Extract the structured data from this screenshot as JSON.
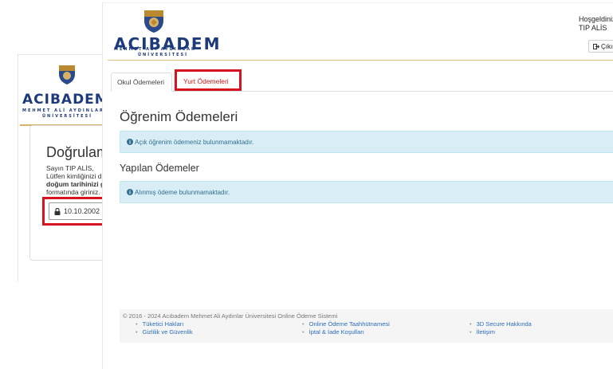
{
  "brand": {
    "name": "ACIBADEM",
    "sub_line1": "MEHMET ALİ AYDINLAR",
    "sub_line2": "ÜNİVERSİTESİ",
    "gold": "#d8b26a",
    "navy": "#1d3a7a"
  },
  "background_window": {
    "title": "Doğrulama",
    "text_line1": "Sayın TIP ALİS,",
    "text_line2": "Lütfen kimliğinizi d",
    "text_line3": "doğum tarihinizi gü",
    "text_line4": "formatında giriniz.",
    "input_value": "10.10.2002",
    "input_icon": "lock-icon"
  },
  "header": {
    "welcome": "Hoşgeldiniz,",
    "user": "TIP ALİS",
    "logout_label": "Çıkış",
    "logout_icon": "sign-out-icon"
  },
  "tabs": [
    {
      "label": "Okul Ödemeleri",
      "active": true
    },
    {
      "label": "Yurt Ödemeleri",
      "active": false,
      "highlighted": true
    }
  ],
  "main": {
    "title": "Öğrenim Ödemeleri",
    "alert_1": "Açık öğrenim ödemeniz bulunmamaktadır.",
    "subtitle": "Yapılan Ödemeler",
    "alert_2": "Alınmış ödeme bulunmamaktadır.",
    "alert_icon": "info-icon"
  },
  "footer": {
    "copyright": "© 2016 - 2024 Acıbadem Mehmet Ali Aydınlar Üniversitesi Online Ödeme Sistemi",
    "links": [
      "Tüketici Hakları",
      "Online Ödeme Taahhütnamesi",
      "3D Secure Hakkında",
      "Gizlilik ve Güvenlik",
      "İptal & İade Koşulları",
      "İletişim"
    ]
  },
  "colors": {
    "highlight_red": "#d6131e",
    "alert_bg": "#d9edf7",
    "alert_text": "#31708f",
    "link": "#2a6ebb"
  }
}
